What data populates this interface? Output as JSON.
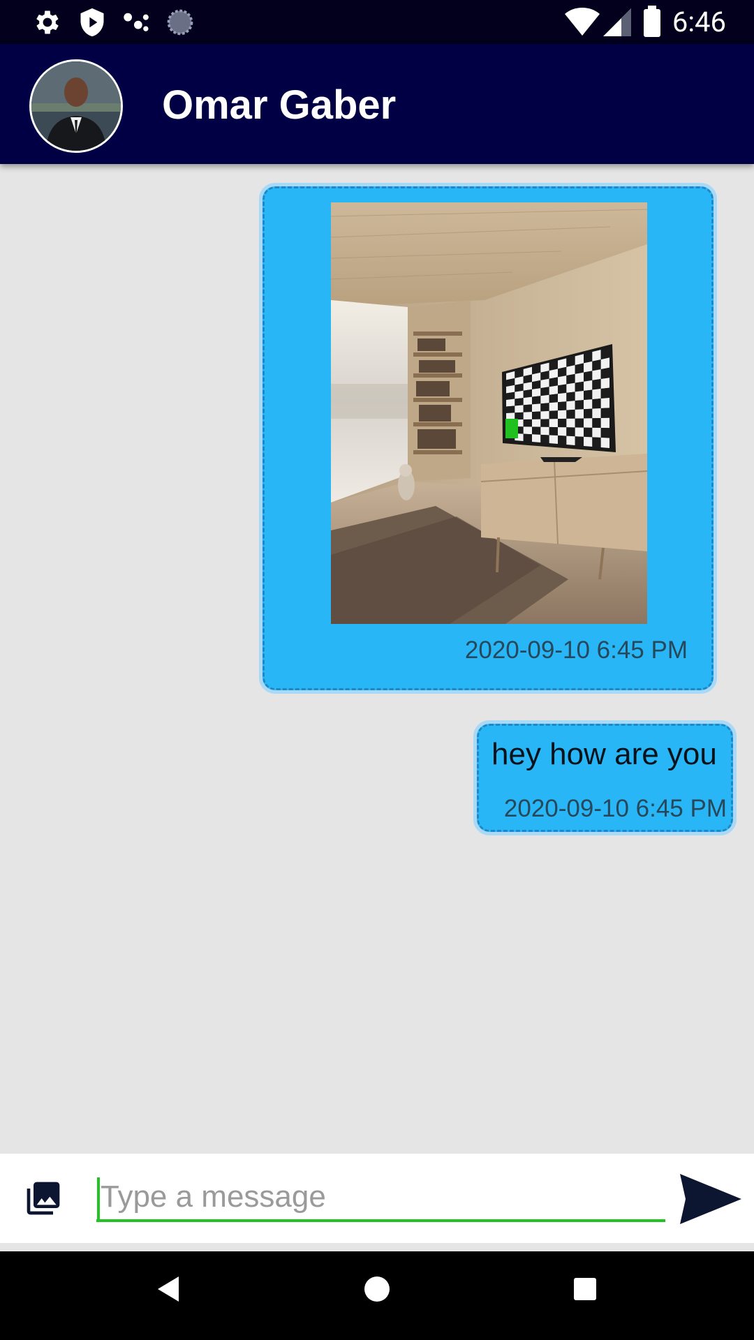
{
  "status_bar": {
    "time": "6:46",
    "left_icons": [
      "settings-icon",
      "shield-play-icon",
      "dots-icon",
      "loading-circle-icon"
    ],
    "right_icons": [
      "wifi-icon",
      "signal-icon",
      "battery-icon"
    ]
  },
  "header": {
    "contact_name": "Omar Gaber"
  },
  "messages": [
    {
      "type": "image",
      "timestamp": "2020-09-10 6:45 PM"
    },
    {
      "type": "text",
      "text": "hey how are you",
      "timestamp": "2020-09-10 6:45 PM"
    }
  ],
  "composer": {
    "placeholder": "Type a message",
    "value": ""
  },
  "colors": {
    "app_bar": "#020045",
    "status_bar": "#02001c",
    "bubble": "#29b6f6",
    "chat_background": "#e5e5e5",
    "input_underline": "#22c322"
  }
}
